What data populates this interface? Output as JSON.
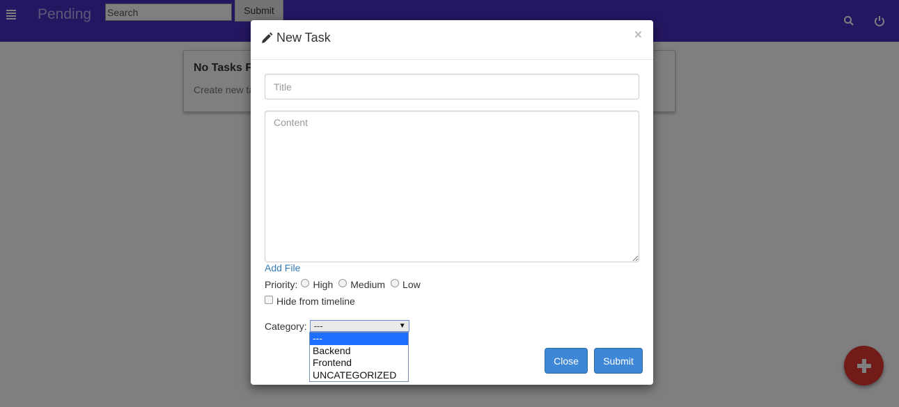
{
  "navbar": {
    "brand": "Pending",
    "search_placeholder": "Search",
    "submit_label": "Submit",
    "icons": [
      "menu-icon",
      "search-icon",
      "power-icon"
    ]
  },
  "main": {
    "empty_title": "No Tasks F",
    "empty_text": "Create new ta"
  },
  "modal": {
    "title": "New Task",
    "title_icon": "pencil-icon",
    "close_symbol": "×",
    "title_placeholder": "Title",
    "content_placeholder": "Content",
    "add_file_label": "Add File",
    "priority_label": "Priority:",
    "priority_options": [
      "High",
      "Medium",
      "Low"
    ],
    "hide_label": "Hide from timeline",
    "category_label": "Category:",
    "category_selected": "---",
    "category_options": [
      "---",
      "Backend",
      "Frontend",
      "UNCATEGORIZED"
    ],
    "close_button": "Close",
    "submit_button": "Submit"
  },
  "colors": {
    "navbar": "#4a2dc2",
    "primary": "#3e87d6",
    "fab": "#e53935",
    "link": "#337ab7"
  }
}
